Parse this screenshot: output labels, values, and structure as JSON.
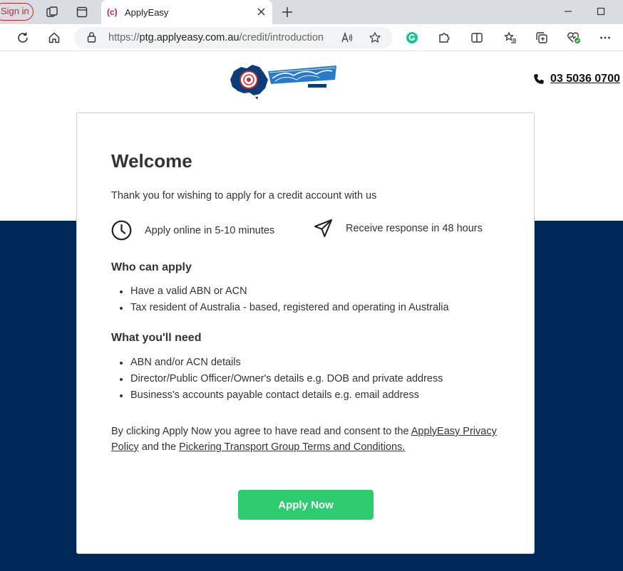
{
  "browser": {
    "signin_label": "Sign in",
    "tab": {
      "favicon_text": "(c)",
      "title": "ApplyEasy"
    },
    "url": {
      "prefix": "https://",
      "host": "ptg.applyeasy.com.au",
      "path": "/credit/introduction"
    }
  },
  "header": {
    "logo_alt": "Pickering Transport Group",
    "phone": "03 5036 0700"
  },
  "card": {
    "title": "Welcome",
    "intro": "Thank you for wishing to apply for a credit account with us",
    "features": [
      {
        "icon": "clock-icon",
        "text": "Apply online in 5-10 minutes"
      },
      {
        "icon": "paper-plane-icon",
        "text": "Receive response in 48 hours"
      }
    ],
    "who": {
      "heading": "Who can apply",
      "items": [
        "Have a valid ABN or ACN",
        "Tax resident of Australia - based, registered and operating in Australia"
      ]
    },
    "need": {
      "heading": "What you'll need",
      "items": [
        "ABN and/or ACN details",
        "Director/Public Officer/Owner's details e.g. DOB and private address",
        "Business's accounts payable contact details e.g. email address"
      ]
    },
    "consent": {
      "text1": "By clicking Apply Now you agree to have read and consent to the ",
      "link1": "ApplyEasy Privacy Policy",
      "text2": " and the ",
      "link2": "Pickering Transport Group Terms and Conditions."
    },
    "apply_label": "Apply Now"
  },
  "colors": {
    "navy": "#00295a",
    "green": "#2ecc71",
    "brand_red": "#c62828"
  }
}
